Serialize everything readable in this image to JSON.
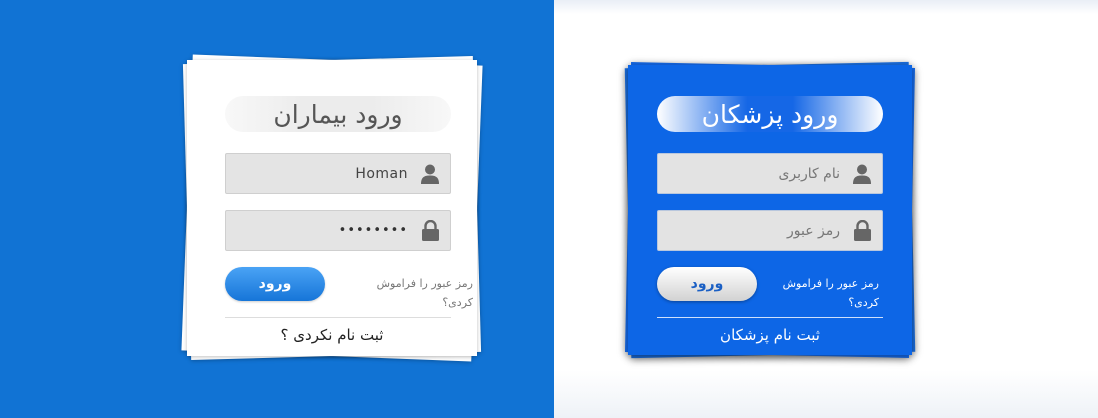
{
  "colors": {
    "left_background": "#1173d4",
    "right_background": "#ffffff",
    "patient_button": "#1675d8",
    "doctor_card": "#0d66e6"
  },
  "patient_login": {
    "title": "ورود بیماران",
    "username": {
      "value": "Homan",
      "icon": "user-icon"
    },
    "password": {
      "value": "••••••••",
      "icon": "lock-icon"
    },
    "login_button": "ورود",
    "forgot_password": "رمز عبور را فراموش کردی؟",
    "register_link": "ثبت نام نکردی ؟"
  },
  "doctor_login": {
    "title": "ورود پزشکان",
    "username": {
      "placeholder": "نام کاربری",
      "icon": "user-icon"
    },
    "password": {
      "placeholder": "رمز عبور",
      "icon": "lock-icon"
    },
    "login_button": "ورود",
    "forgot_password": "رمز عبور را فراموش کردی؟",
    "register_link": "ثبت نام پزشکان"
  }
}
